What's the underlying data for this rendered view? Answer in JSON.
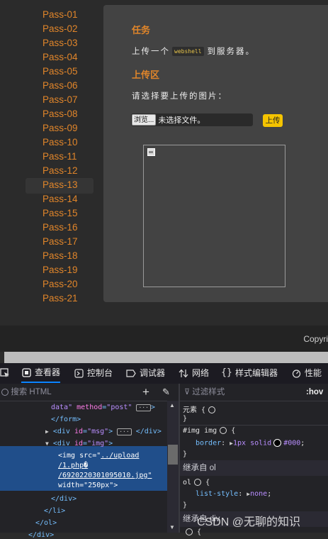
{
  "sidebar": {
    "items": [
      "Pass-01",
      "Pass-02",
      "Pass-03",
      "Pass-04",
      "Pass-05",
      "Pass-06",
      "Pass-07",
      "Pass-08",
      "Pass-09",
      "Pass-10",
      "Pass-11",
      "Pass-12",
      "Pass-13",
      "Pass-14",
      "Pass-15",
      "Pass-16",
      "Pass-17",
      "Pass-18",
      "Pass-19",
      "Pass-20",
      "Pass-21"
    ],
    "active": "Pass-13"
  },
  "panel": {
    "task_heading": "任务",
    "task_text_before": "上传一个",
    "task_code": "webshell",
    "task_text_after": "到服务器。",
    "upload_heading": "上传区",
    "select_label": "请选择要上传的图片：",
    "browse_label": "浏览...",
    "file_status": "未选择文件。",
    "upload_button": "上传"
  },
  "footer": {
    "copyright": "Copyri"
  },
  "devtools": {
    "tabs": [
      "查看器",
      "控制台",
      "调试器",
      "网络",
      "样式编辑器",
      "性能"
    ],
    "active_tab": "查看器",
    "html_search_placeholder": "搜索 HTML",
    "html_lines": {
      "l1_attr_tail": "data\"",
      "l1_attr": "method",
      "l1_val": "\"post\"",
      "l2": "</form>",
      "l3_open": "<div",
      "l3_attr": "id",
      "l3_val": "\"msg\"",
      "l3_close": "</div>",
      "l4_open": "<div",
      "l4_attr": "id",
      "l4_val": "\"img\"",
      "l5_tag": "<img",
      "l5_attr": "src",
      "l5_val": "../upload",
      "l6_val": "/1.php�",
      "l7_val": "/6920220301095010.jpg\"",
      "l8_attr": "width",
      "l8_val": "\"250px\"",
      "l9": "</div>",
      "l10": "</li>",
      "l11": "</ol>",
      "l12": "</div>"
    },
    "rules": {
      "filter_placeholder": "过滤样式",
      "hov": ":hov",
      "element_selector": "元素",
      "element_brace_open": "{",
      "element_brace_close": "}",
      "rule2_selector": "#img img",
      "rule2_prop": "border",
      "rule2_val": "1px solid",
      "rule2_color": "#000",
      "inherit_heading": "继承自 ol",
      "ol_selector": "ol",
      "ol_prop": "list-style",
      "ol_val": "none",
      "inherit_heading2": "继承自 div"
    }
  },
  "watermark": "CSDN @无聊的知识"
}
